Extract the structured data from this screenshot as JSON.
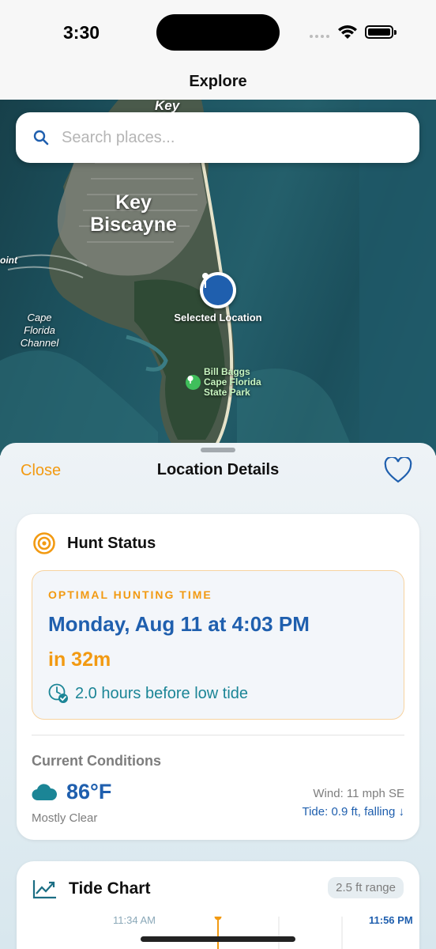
{
  "status_bar": {
    "time": "3:30"
  },
  "nav": {
    "title": "Explore"
  },
  "map": {
    "labels": {
      "key_top": "Key",
      "key_biscayne": "Key Biscayne",
      "point_left": "oint",
      "cape_channel": "Cape Florida Channel",
      "park": "Bill Baggs Cape Florida State Park",
      "selected": "Selected Location"
    }
  },
  "search": {
    "placeholder": "Search places..."
  },
  "sheet": {
    "close_label": "Close",
    "title": "Location Details"
  },
  "hunt": {
    "title": "Hunt Status",
    "eyebrow": "OPTIMAL HUNTING TIME",
    "date": "Monday, Aug 11 at 4:03 PM",
    "countdown": "in 32m",
    "tide_note": "2.0 hours before low tide",
    "conditions_heading": "Current Conditions",
    "temperature": "86°F",
    "sky": "Mostly Clear",
    "wind": "Wind: 11 mph SE",
    "tide": "Tide: 0.9 ft, falling ↓"
  },
  "tide_chart": {
    "title": "Tide Chart",
    "range_badge": "2.5 ft range",
    "left_time": "11:34 AM",
    "right_time": "11:56 PM"
  },
  "colors": {
    "accent_orange": "#f29a12",
    "accent_blue": "#1f5fae",
    "teal": "#1b8596"
  }
}
